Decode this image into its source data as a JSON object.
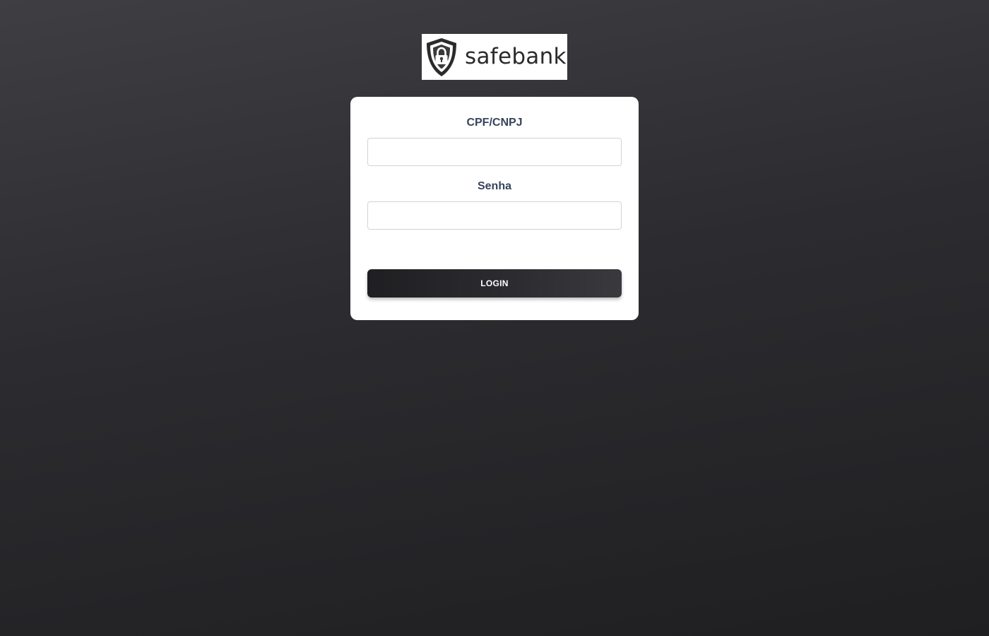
{
  "brand": {
    "name": "safebank",
    "logo_icon": "shield-lock-icon"
  },
  "login_form": {
    "cpf_label": "CPF/CNPJ",
    "cpf_value": "",
    "senha_label": "Senha",
    "senha_value": "",
    "login_label": "LOGIN"
  },
  "colors": {
    "background_top": "#3e3e43",
    "background_bottom": "#1f1f21",
    "label_text": "#36445c",
    "button_dark": "#1f1f22",
    "card": "#ffffff"
  }
}
